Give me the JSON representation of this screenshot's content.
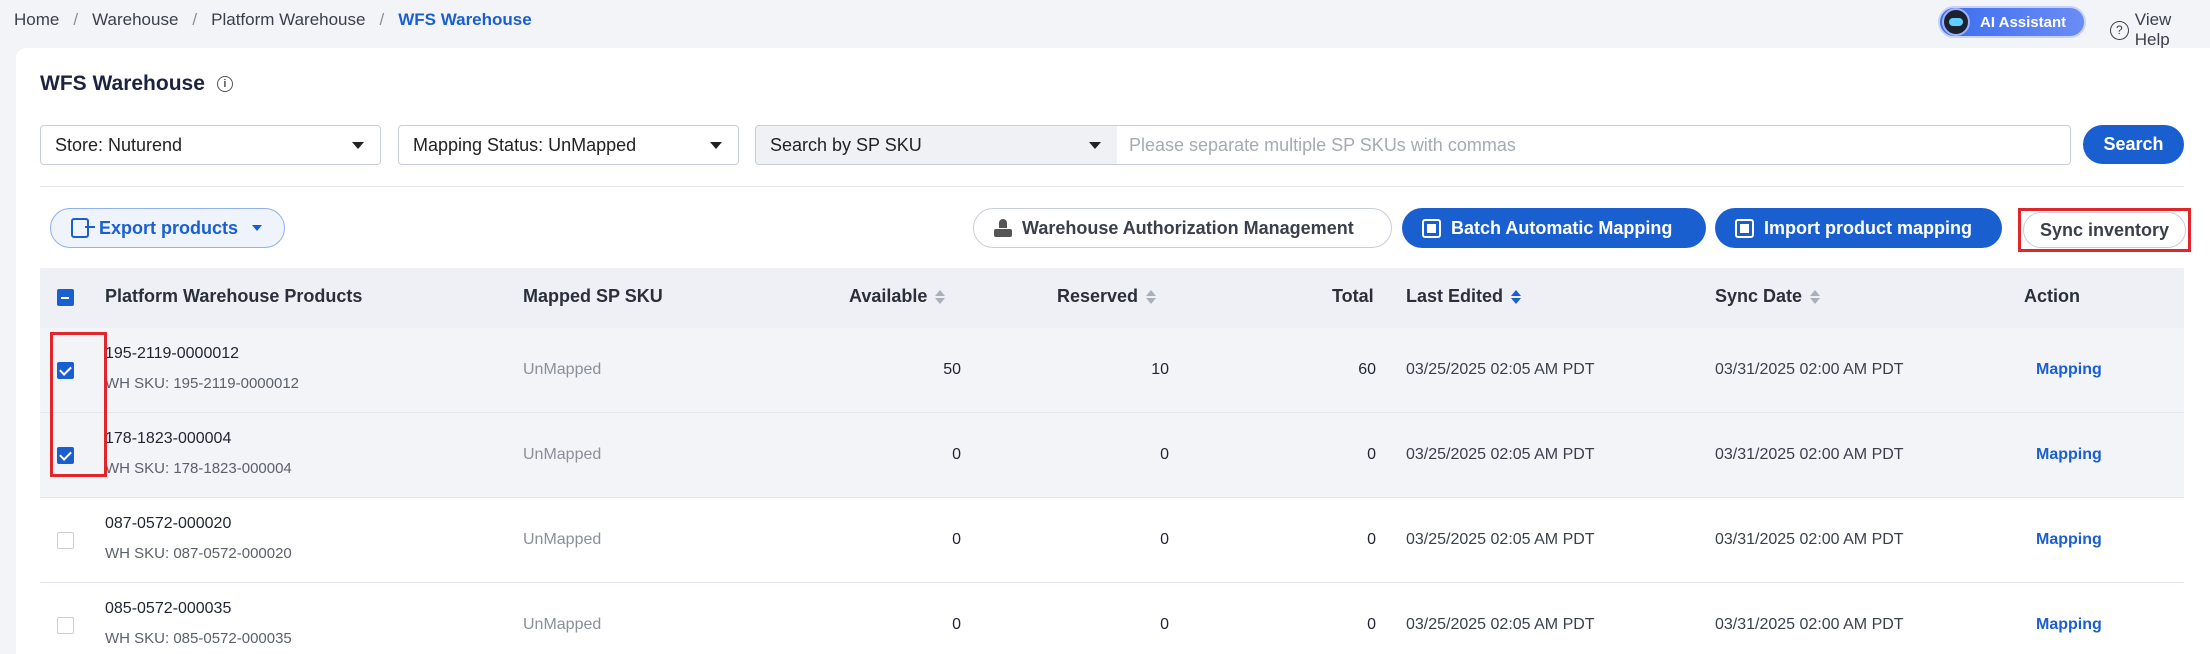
{
  "breadcrumb": {
    "home": "Home",
    "warehouse": "Warehouse",
    "platform_warehouse": "Platform Warehouse",
    "current": "WFS Warehouse"
  },
  "header": {
    "ai_assistant": "AI Assistant",
    "view_help": "View Help"
  },
  "page": {
    "title": "WFS Warehouse"
  },
  "filters": {
    "store": "Store: Nuturend",
    "mapping_status": "Mapping Status: UnMapped",
    "search_type": "Search by SP SKU",
    "search_placeholder": "Please separate multiple SP SKUs with commas",
    "search_button": "Search"
  },
  "toolbar": {
    "export": "Export products",
    "auth_mgmt": "Warehouse Authorization Management",
    "batch_mapping": "Batch Automatic Mapping",
    "import_mapping": "Import product mapping",
    "sync_inventory": "Sync inventory"
  },
  "table": {
    "headers": {
      "product": "Platform Warehouse Products",
      "mapped": "Mapped SP SKU",
      "available": "Available",
      "reserved": "Reserved",
      "total": "Total",
      "last_edited": "Last Edited",
      "sync_date": "Sync Date",
      "action": "Action"
    },
    "rows": [
      {
        "sku": "195-2119-0000012",
        "wh_sku": "WH SKU: 195-2119-0000012",
        "mapped": "UnMapped",
        "available": "50",
        "reserved": "10",
        "total": "60",
        "last_edited": "03/25/2025 02:05 AM PDT",
        "sync_date": "03/31/2025 02:00 AM PDT",
        "action": "Mapping",
        "checked": true
      },
      {
        "sku": "178-1823-000004",
        "wh_sku": "WH SKU: 178-1823-000004",
        "mapped": "UnMapped",
        "available": "0",
        "reserved": "0",
        "total": "0",
        "last_edited": "03/25/2025 02:05 AM PDT",
        "sync_date": "03/31/2025 02:00 AM PDT",
        "action": "Mapping",
        "checked": true
      },
      {
        "sku": "087-0572-000020",
        "wh_sku": "WH SKU: 087-0572-000020",
        "mapped": "UnMapped",
        "available": "0",
        "reserved": "0",
        "total": "0",
        "last_edited": "03/25/2025 02:05 AM PDT",
        "sync_date": "03/31/2025 02:00 AM PDT",
        "action": "Mapping",
        "checked": false
      },
      {
        "sku": "085-0572-000035",
        "wh_sku": "WH SKU: 085-0572-000035",
        "mapped": "UnMapped",
        "available": "0",
        "reserved": "0",
        "total": "0",
        "last_edited": "03/25/2025 02:05 AM PDT",
        "sync_date": "03/31/2025 02:00 AM PDT",
        "action": "Mapping",
        "checked": false
      }
    ]
  },
  "colors": {
    "primary": "#1a5fd0",
    "highlight": "#e0262b"
  }
}
